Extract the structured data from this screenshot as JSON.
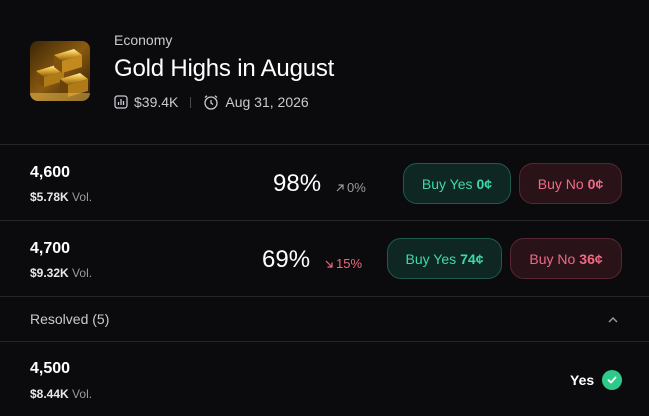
{
  "market": {
    "category": "Economy",
    "title": "Gold Highs in August",
    "volume": "$39.4K",
    "end_date": "Aug 31, 2026",
    "thumbnail_icon": "gold-bars-image"
  },
  "outcomes": [
    {
      "label": "4,600",
      "volume": "$5.78K",
      "volume_suffix": "Vol.",
      "probability": "98%",
      "change": "0%",
      "change_direction": "flat",
      "buy_yes_label": "Buy Yes",
      "buy_yes_price": "0¢",
      "buy_no_label": "Buy No",
      "buy_no_price": "0¢"
    },
    {
      "label": "4,700",
      "volume": "$9.32K",
      "volume_suffix": "Vol.",
      "probability": "69%",
      "change": "15%",
      "change_direction": "down",
      "buy_yes_label": "Buy Yes",
      "buy_yes_price": "74¢",
      "buy_no_label": "Buy No",
      "buy_no_price": "36¢"
    }
  ],
  "resolved": {
    "label": "Resolved (5)",
    "items": [
      {
        "label": "4,500",
        "volume": "$8.44K",
        "volume_suffix": "Vol.",
        "result": "Yes"
      }
    ]
  },
  "colors": {
    "background": "#0b0b0e",
    "yes_accent": "#3fd8ac",
    "no_accent": "#ef6a84",
    "down": "#ef6a78",
    "resolved_check": "#2fc98a"
  }
}
